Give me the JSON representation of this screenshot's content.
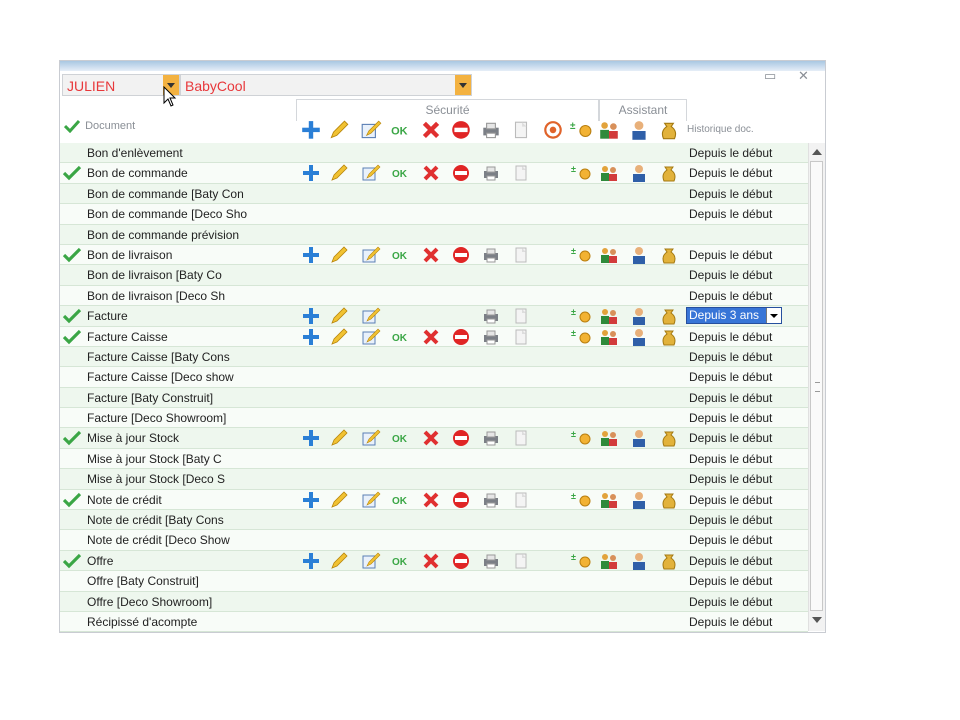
{
  "user": {
    "value": "JULIEN"
  },
  "company": {
    "value": "BabyCool"
  },
  "header": {
    "security_label": "Sécurité",
    "assistant_label": "Assistant",
    "document_label": "Document",
    "history_label": "Historique doc."
  },
  "icons": {
    "add": "plus-icon",
    "edit": "pencil-icon",
    "edit_modify": "edit-modify-icon",
    "ok": "OK",
    "delete": "red-x-icon",
    "block": "no-entry-icon",
    "print": "printer-icon",
    "copy": "document-copy-icon",
    "target": "target-icon",
    "currency": "plus-minus-currency-icon",
    "users": "group-icon",
    "person": "person-icon",
    "money": "money-bag-icon"
  },
  "colors": {
    "accent": "#f3b241",
    "combo_text": "#e8383b",
    "check": "#3aa645",
    "selection": "#3875d7"
  },
  "rows": [
    {
      "label": "Bon d'enlèvement",
      "checked": false,
      "icons": "none",
      "history": "Depuis le début"
    },
    {
      "label": "Bon de commande",
      "checked": true,
      "icons": "full",
      "history": "Depuis le début"
    },
    {
      "label": "Bon de commande [Baty Con",
      "checked": false,
      "icons": "none",
      "history": "Depuis le début"
    },
    {
      "label": "Bon de commande [Deco Sho",
      "checked": false,
      "icons": "none",
      "history": "Depuis le début"
    },
    {
      "label": "Bon de commande prévision",
      "checked": false,
      "icons": "none",
      "history": ""
    },
    {
      "label": "Bon de livraison",
      "checked": true,
      "icons": "full",
      "history": "Depuis le début"
    },
    {
      "label": "Bon de livraison [Baty Co",
      "checked": false,
      "icons": "none",
      "history": "Depuis le début"
    },
    {
      "label": "Bon de livraison [Deco Sh",
      "checked": false,
      "icons": "none",
      "history": "Depuis le début"
    },
    {
      "label": "Facture",
      "checked": true,
      "icons": "partial",
      "history": "Depuis 3 ans",
      "selected": true
    },
    {
      "label": "Facture Caisse",
      "checked": true,
      "icons": "full",
      "history": "Depuis le début"
    },
    {
      "label": "Facture Caisse [Baty Cons",
      "checked": false,
      "icons": "none",
      "history": "Depuis le début"
    },
    {
      "label": "Facture Caisse [Deco show",
      "checked": false,
      "icons": "none",
      "history": "Depuis le début"
    },
    {
      "label": "Facture [Baty Construit]",
      "checked": false,
      "icons": "none",
      "history": "Depuis le début"
    },
    {
      "label": "Facture [Deco Showroom]",
      "checked": false,
      "icons": "none",
      "history": "Depuis le début"
    },
    {
      "label": "Mise à jour Stock",
      "checked": true,
      "icons": "full",
      "history": "Depuis le début"
    },
    {
      "label": "Mise à jour Stock [Baty C",
      "checked": false,
      "icons": "none",
      "history": "Depuis le début"
    },
    {
      "label": "Mise à jour Stock [Deco S",
      "checked": false,
      "icons": "none",
      "history": "Depuis le début"
    },
    {
      "label": "Note de crédit",
      "checked": true,
      "icons": "full",
      "history": "Depuis le début"
    },
    {
      "label": "Note de crédit [Baty Cons",
      "checked": false,
      "icons": "none",
      "history": "Depuis le début"
    },
    {
      "label": "Note de crédit [Deco Show",
      "checked": false,
      "icons": "none",
      "history": "Depuis le début"
    },
    {
      "label": "Offre",
      "checked": true,
      "icons": "full",
      "history": "Depuis le début"
    },
    {
      "label": "Offre [Baty Construit]",
      "checked": false,
      "icons": "none",
      "history": "Depuis le début"
    },
    {
      "label": "Offre [Deco Showroom]",
      "checked": false,
      "icons": "none",
      "history": "Depuis le début"
    },
    {
      "label": "Récipissé d'acompte",
      "checked": false,
      "icons": "none",
      "history": "Depuis le début"
    }
  ]
}
